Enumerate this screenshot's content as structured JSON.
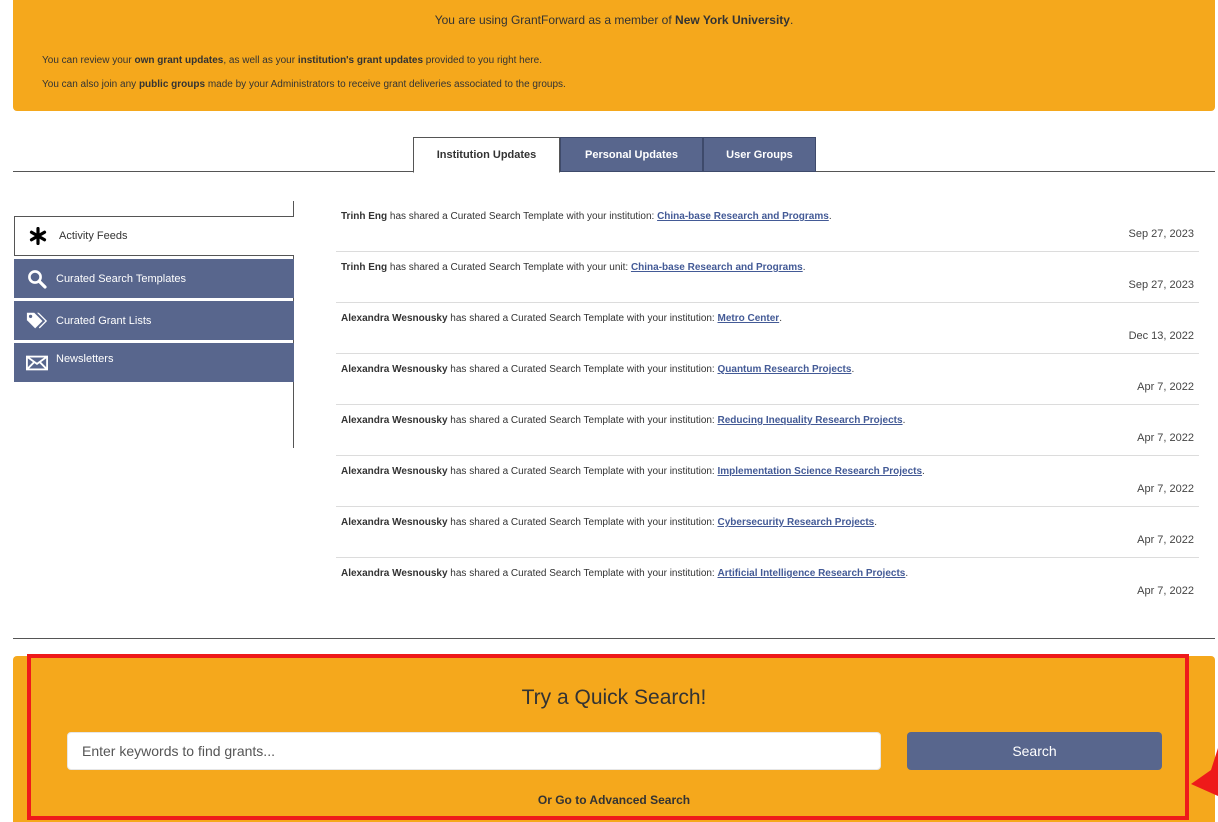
{
  "banner": {
    "member_prefix": "You are using GrantForward as a member of ",
    "member_org": "New York University",
    "member_suffix": ".",
    "line1": {
      "t1": "You can review your ",
      "b1": "own grant updates",
      "t2": ", as well as your ",
      "b2": "institution's grant updates",
      "t3": " provided to you right here."
    },
    "line2": {
      "t1": "You can also join any ",
      "b1": "public groups",
      "t2": " made by your Administrators to receive grant deliveries associated to the groups."
    }
  },
  "tabs": [
    {
      "label": "Institution Updates",
      "active": true
    },
    {
      "label": "Personal Updates",
      "active": false
    },
    {
      "label": "User Groups",
      "active": false
    }
  ],
  "nav": [
    {
      "label": "Activity Feeds",
      "icon": "asterisk-icon",
      "active": true
    },
    {
      "label": "Curated Search Templates",
      "icon": "search-icon",
      "active": false
    },
    {
      "label": "Curated Grant Lists",
      "icon": "tags-icon",
      "active": false
    },
    {
      "label": "Newsletters",
      "icon": "envelope-icon",
      "active": false
    }
  ],
  "feed": [
    {
      "actor": "Trinh Eng",
      "text": " has shared a Curated Search Template with your institution: ",
      "link": "China-base Research and Programs",
      "end": ".",
      "date": "Sep 27, 2023"
    },
    {
      "actor": "Trinh Eng",
      "text": " has shared a Curated Search Template with your unit: ",
      "link": "China-base Research and Programs",
      "end": ".",
      "date": "Sep 27, 2023"
    },
    {
      "actor": "Alexandra Wesnousky",
      "text": " has shared a Curated Search Template with your institution: ",
      "link": "Metro Center",
      "end": ".",
      "date": "Dec 13, 2022"
    },
    {
      "actor": "Alexandra Wesnousky",
      "text": " has shared a Curated Search Template with your institution: ",
      "link": "Quantum Research Projects",
      "end": ".",
      "date": "Apr 7, 2022"
    },
    {
      "actor": "Alexandra Wesnousky",
      "text": " has shared a Curated Search Template with your institution: ",
      "link": "Reducing Inequality Research Projects",
      "end": ".",
      "date": "Apr 7, 2022"
    },
    {
      "actor": "Alexandra Wesnousky",
      "text": " has shared a Curated Search Template with your institution: ",
      "link": "Implementation Science Research Projects",
      "end": ".",
      "date": "Apr 7, 2022"
    },
    {
      "actor": "Alexandra Wesnousky",
      "text": " has shared a Curated Search Template with your institution: ",
      "link": "Cybersecurity Research Projects",
      "end": ".",
      "date": "Apr 7, 2022"
    },
    {
      "actor": "Alexandra Wesnousky",
      "text": " has shared a Curated Search Template with your institution: ",
      "link": "Artificial Intelligence Research Projects",
      "end": ".",
      "date": "Apr 7, 2022"
    }
  ],
  "quick_search": {
    "title": "Try a Quick Search!",
    "placeholder": "Enter keywords to find grants...",
    "button": "Search",
    "advanced": "Or Go to Advanced Search"
  },
  "colors": {
    "banner": "#f5a81c",
    "nav_active_bg": "#58668d",
    "link": "#435a96",
    "highlight": "#ee1a1a"
  }
}
